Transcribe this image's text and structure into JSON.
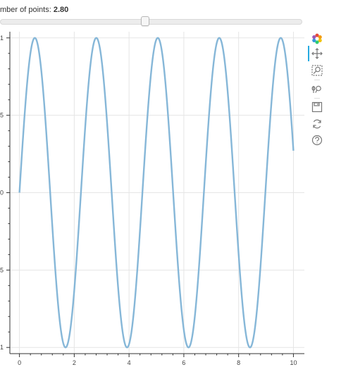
{
  "slider": {
    "label": "mber of points: ",
    "value_text": "2.80",
    "value": 2.8,
    "fraction": 0.48
  },
  "toolbar": {
    "tools": [
      {
        "name": "bokeh-logo-icon",
        "interactable": false
      },
      {
        "name": "pan-tool-icon",
        "interactable": true,
        "active": true
      },
      {
        "name": "box-zoom-tool-icon",
        "interactable": true
      },
      {
        "name": "wheel-zoom-tool-icon",
        "interactable": true
      },
      {
        "name": "save-tool-icon",
        "interactable": true
      },
      {
        "name": "reset-tool-icon",
        "interactable": true
      },
      {
        "name": "help-tool-icon",
        "interactable": true
      }
    ]
  },
  "chart_data": {
    "type": "line",
    "title": "",
    "xlabel": "",
    "ylabel": "",
    "xlim": [
      -0.35,
      10.4
    ],
    "ylim": [
      -1.04,
      1.04
    ],
    "x_ticks": [
      0,
      2,
      4,
      6,
      8,
      10
    ],
    "x_tick_labels": [
      "0",
      "2",
      "4",
      "6",
      "8",
      "10"
    ],
    "y_ticks": [
      -1,
      -0.5,
      0,
      0.5,
      1
    ],
    "y_tick_labels": [
      "1",
      "5",
      "0",
      "5",
      "1"
    ],
    "grid": true,
    "legend": "none",
    "series": [
      {
        "function": "sin(2.80 * x)",
        "frequency": 2.8,
        "x_range": [
          0,
          10
        ],
        "color": "#86b7d8"
      }
    ]
  },
  "colors": {
    "line": "#86b7d8",
    "grid": "#e5e5e5",
    "axis": "#333333",
    "active_tool": "#26aae1"
  }
}
